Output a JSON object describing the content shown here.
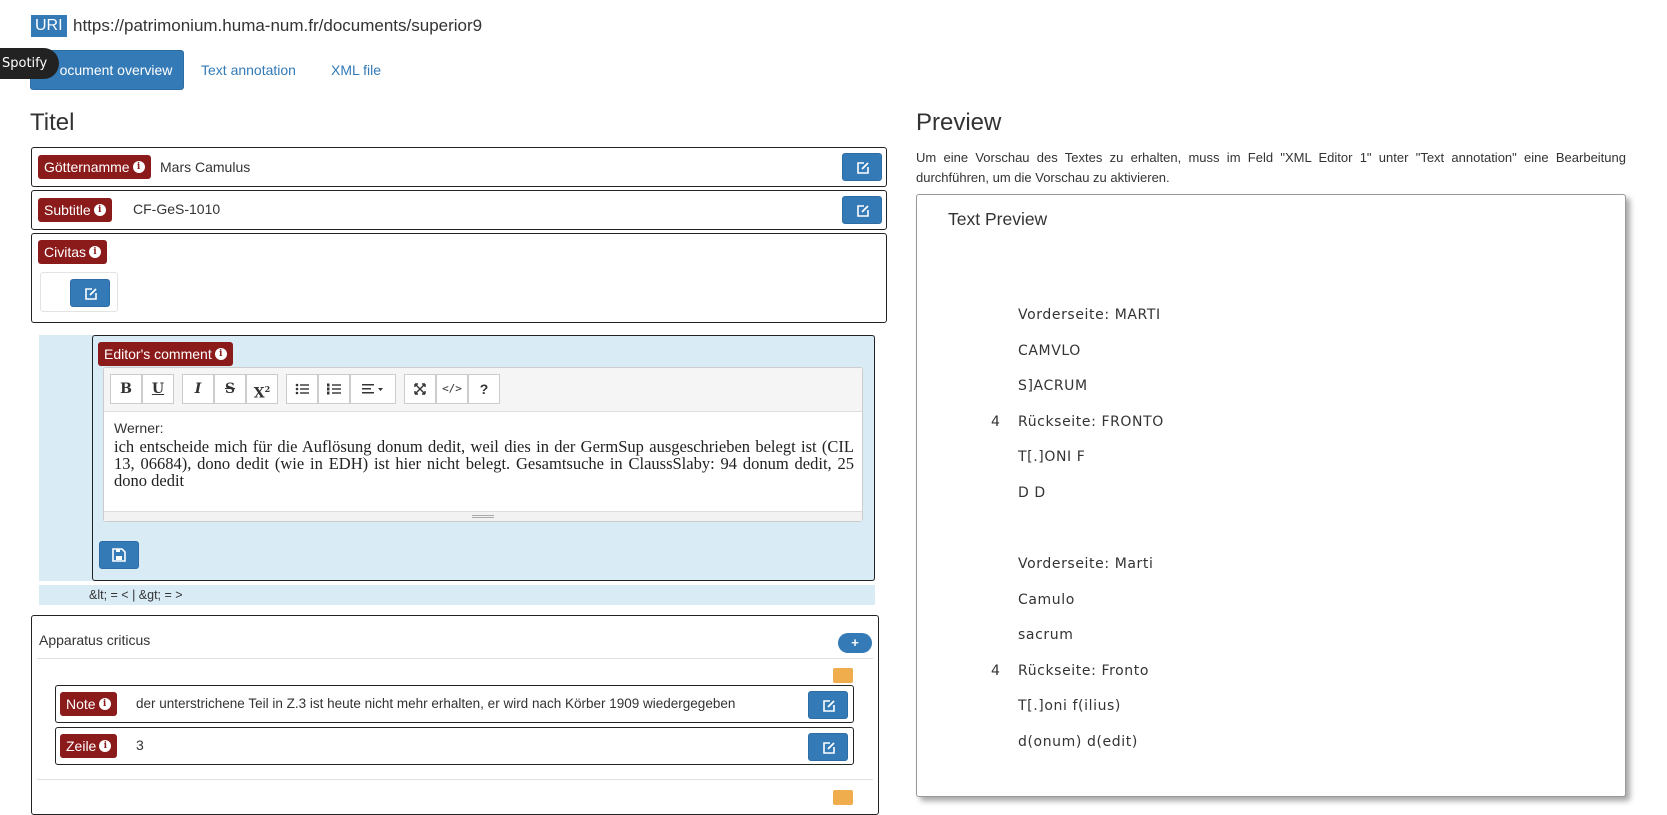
{
  "uri": {
    "badge": "URI",
    "url": "https://patrimonium.huma-num.fr/documents/superior9"
  },
  "tabs": [
    {
      "label": "Document overview",
      "visible_label": "ocument overview"
    },
    {
      "label": "Text annotation"
    },
    {
      "label": "XML file"
    }
  ],
  "tooltip": "Spotify",
  "left": {
    "title": "Titel",
    "fields": [
      {
        "label": "Götternamme",
        "value": "Mars Camulus"
      },
      {
        "label": "Subtitle",
        "value": "CF-GeS-1010"
      },
      {
        "label": "Civitas",
        "value": ""
      }
    ],
    "editor_comment": {
      "label": "Editor's comment",
      "toolbar": [
        "B",
        "U",
        "I",
        "S",
        "X²",
        "bulleted-list",
        "numbered-list",
        "align",
        "fullscreen",
        "</>",
        "?"
      ],
      "author": "Werner:",
      "text": "ich entscheide mich für die Auflösung donum dedit, weil dies in der GermSup ausgeschrieben belegt ist (CIL 13, 06684), dono dedit (wie in EDH) ist hier nicht belegt. Gesamtsuche in ClaussSlaby: 94 donum dedit, 25 dono dedit"
    },
    "entity_hint": "&lt; = < | &gt; = >",
    "apparatus": {
      "title": "Apparatus criticus",
      "add_label": "+",
      "entries": [
        {
          "label": "Note",
          "value": "der unterstrichene Teil in Z.3 ist heute nicht mehr erhalten, er wird nach Körber 1909 wiedergegeben"
        },
        {
          "label": "Zeile",
          "value": "3"
        }
      ]
    }
  },
  "right": {
    "title": "Preview",
    "note": "Um eine Vorschau des Textes zu erhalten, muss im Feld \"XML Editor 1\" unter \"Text annotation\" eine Bearbeitung durchführen, um die Vorschau zu aktivieren.",
    "box_title": "Text Preview",
    "diplomatic": [
      {
        "num": "",
        "text": "Vorderseite: MARTI"
      },
      {
        "num": "",
        "text": "CAMVLO"
      },
      {
        "num": "",
        "text": "S]ACRUM"
      },
      {
        "num": "4",
        "text": "Rückseite: FRONTO"
      },
      {
        "num": "",
        "text": "T[.]ONI F"
      },
      {
        "num": "",
        "text": "D D"
      }
    ],
    "edition": [
      {
        "num": "",
        "text": "Vorderseite: Marti"
      },
      {
        "num": "",
        "text": "Camulo"
      },
      {
        "num": "",
        "text": "sacrum"
      },
      {
        "num": "4",
        "text": "Rückseite: Fronto"
      },
      {
        "num": "",
        "text": "T[.]oni f(ilius)"
      },
      {
        "num": "",
        "text": "d(onum) d(edit)"
      }
    ]
  },
  "colors": {
    "primary": "#337ab7",
    "label": "#8b1a1a",
    "panel": "#d9ebf5",
    "warning": "#f0ad4e"
  }
}
